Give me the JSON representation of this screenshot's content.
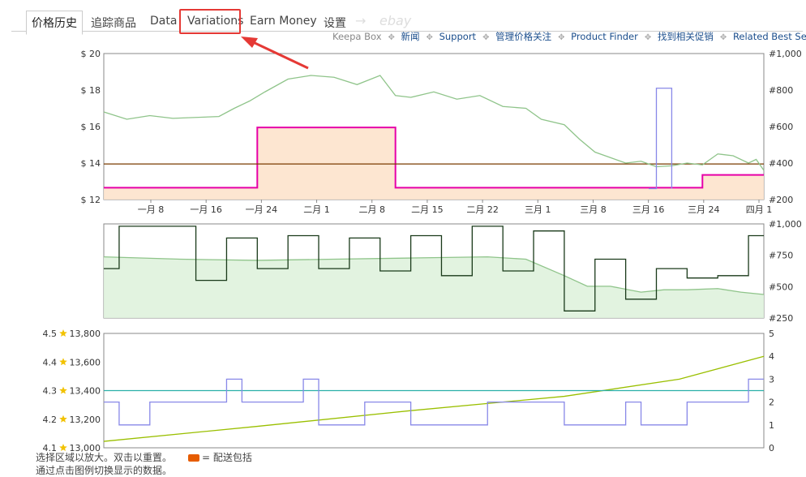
{
  "tabs": [
    {
      "label": "价格历史",
      "active": true
    },
    {
      "label": "追踪商品"
    },
    {
      "label": "Data"
    },
    {
      "label": "Variations",
      "highlighted": true
    },
    {
      "label": "Earn Money"
    },
    {
      "label": "设置"
    },
    {
      "label": "→",
      "decorative": true
    },
    {
      "label": "ebay",
      "decorative": true
    }
  ],
  "links": [
    "Keepa Box",
    "新闻",
    "Support",
    "管理价格关注",
    "Product Finder",
    "找到相关促销",
    "Related Best Sellers"
  ],
  "annotation": {
    "arrow_color": "#e53935",
    "highlight_color": "#e53935"
  },
  "footer": {
    "line1": "选择区域以放大。双击以重置。",
    "shipping_label": "= 配送包括",
    "line2": "通过点击图例切换显示的数据。"
  },
  "chart_data": [
    {
      "type": "line",
      "id": "price",
      "x_ticks": [
        "一月 8",
        "一月 16",
        "一月 24",
        "二月 1",
        "二月 8",
        "二月 15",
        "二月 22",
        "三月 1",
        "三月 8",
        "三月 16",
        "三月 24",
        "四月 1"
      ],
      "y_left": {
        "ticks": [
          "$ 12",
          "$ 14",
          "$ 16",
          "$ 18",
          "$ 20"
        ],
        "range": [
          12,
          20
        ]
      },
      "y_right": {
        "ticks": [
          "#200",
          "#400",
          "#600",
          "#800",
          "#1,000"
        ],
        "range": [
          200,
          1000
        ]
      },
      "x_range": [
        0,
        86
      ],
      "series": [
        {
          "key": "amazon",
          "color": "#e600a8",
          "fill": "#fde3cc",
          "axis": "left",
          "points": [
            [
              0,
              12.65
            ],
            [
              20,
              12.65
            ],
            [
              20,
              15.95
            ],
            [
              38,
              15.95
            ],
            [
              38,
              12.65
            ],
            [
              78,
              12.65
            ],
            [
              78,
              13.35
            ],
            [
              86,
              13.35
            ]
          ]
        },
        {
          "key": "new",
          "color": "#7a3b00",
          "axis": "left",
          "points": [
            [
              0,
              13.95
            ],
            [
              86,
              13.95
            ]
          ]
        },
        {
          "key": "sales_rank",
          "color": "#8fc48a",
          "axis": "right",
          "points": [
            [
              0,
              680
            ],
            [
              3,
              640
            ],
            [
              6,
              660
            ],
            [
              9,
              645
            ],
            [
              12,
              650
            ],
            [
              15,
              655
            ],
            [
              17,
              700
            ],
            [
              19,
              740
            ],
            [
              21,
              790
            ],
            [
              24,
              860
            ],
            [
              27,
              880
            ],
            [
              30,
              870
            ],
            [
              33,
              830
            ],
            [
              36,
              880
            ],
            [
              38,
              770
            ],
            [
              40,
              760
            ],
            [
              43,
              790
            ],
            [
              46,
              750
            ],
            [
              49,
              770
            ],
            [
              52,
              710
            ],
            [
              55,
              700
            ],
            [
              57,
              640
            ],
            [
              60,
              610
            ],
            [
              62,
              530
            ],
            [
              64,
              460
            ],
            [
              66,
              430
            ],
            [
              68,
              400
            ],
            [
              70,
              410
            ],
            [
              72,
              380
            ],
            [
              74,
              385
            ],
            [
              76,
              400
            ],
            [
              78,
              390
            ],
            [
              80,
              450
            ],
            [
              82,
              440
            ],
            [
              84,
              400
            ],
            [
              85,
              420
            ],
            [
              86,
              360
            ]
          ]
        },
        {
          "key": "lightning",
          "color": "#8888e8",
          "axis": "right",
          "points": [
            [
              71,
              260
            ],
            [
              72,
              260
            ],
            [
              72,
              810
            ],
            [
              74,
              810
            ],
            [
              74,
              260
            ]
          ]
        }
      ]
    },
    {
      "type": "line",
      "id": "offers",
      "y_right": {
        "ticks": [
          "#250",
          "#500",
          "#750",
          "#1,000"
        ],
        "range": [
          200,
          1000
        ]
      },
      "x_range": [
        0,
        86
      ],
      "series": [
        {
          "key": "rank_area",
          "color": "#8fc48a",
          "fill": "#dff2dd",
          "points": [
            [
              0,
              720
            ],
            [
              10,
              700
            ],
            [
              20,
              690
            ],
            [
              30,
              700
            ],
            [
              40,
              710
            ],
            [
              50,
              720
            ],
            [
              55,
              700
            ],
            [
              60,
              560
            ],
            [
              63,
              470
            ],
            [
              66,
              470
            ],
            [
              70,
              420
            ],
            [
              73,
              440
            ],
            [
              76,
              440
            ],
            [
              80,
              450
            ],
            [
              83,
              420
            ],
            [
              86,
              400
            ]
          ]
        },
        {
          "key": "offer_count",
          "color": "#1a3a1a",
          "points": [
            [
              0,
              620
            ],
            [
              2,
              620
            ],
            [
              2,
              980
            ],
            [
              12,
              980
            ],
            [
              12,
              520
            ],
            [
              16,
              520
            ],
            [
              16,
              880
            ],
            [
              20,
              880
            ],
            [
              20,
              620
            ],
            [
              24,
              620
            ],
            [
              24,
              900
            ],
            [
              28,
              900
            ],
            [
              28,
              620
            ],
            [
              32,
              620
            ],
            [
              32,
              880
            ],
            [
              36,
              880
            ],
            [
              36,
              600
            ],
            [
              40,
              600
            ],
            [
              40,
              900
            ],
            [
              44,
              900
            ],
            [
              44,
              560
            ],
            [
              48,
              560
            ],
            [
              48,
              980
            ],
            [
              52,
              980
            ],
            [
              52,
              600
            ],
            [
              56,
              600
            ],
            [
              56,
              940
            ],
            [
              60,
              940
            ],
            [
              60,
              260
            ],
            [
              64,
              260
            ],
            [
              64,
              700
            ],
            [
              68,
              700
            ],
            [
              68,
              360
            ],
            [
              72,
              360
            ],
            [
              72,
              620
            ],
            [
              76,
              620
            ],
            [
              76,
              540
            ],
            [
              80,
              540
            ],
            [
              80,
              560
            ],
            [
              84,
              560
            ],
            [
              84,
              900
            ],
            [
              86,
              900
            ]
          ]
        }
      ]
    },
    {
      "type": "line",
      "id": "reviews",
      "y_left": {
        "ticks": [
          "4.1",
          "4.2",
          "4.3",
          "4.4",
          "4.5"
        ],
        "range": [
          4.1,
          4.5
        ]
      },
      "y_left2": {
        "ticks": [
          "13,000",
          "13,200",
          "13,400",
          "13,600",
          "13,800"
        ],
        "range": [
          13000,
          13800
        ]
      },
      "y_right": {
        "ticks": [
          "0",
          "1",
          "2",
          "3",
          "4",
          "5"
        ],
        "range": [
          0,
          5
        ]
      },
      "x_range": [
        0,
        86
      ],
      "series": [
        {
          "key": "review_count",
          "color": "#9abf00",
          "axis": "left2",
          "points": [
            [
              0,
              13045
            ],
            [
              20,
              13150
            ],
            [
              40,
              13260
            ],
            [
              60,
              13360
            ],
            [
              75,
              13480
            ],
            [
              86,
              13640
            ]
          ]
        },
        {
          "key": "rating",
          "color": "#2ab0a8",
          "axis": "left",
          "points": [
            [
              0,
              4.3
            ],
            [
              86,
              4.3
            ]
          ]
        },
        {
          "key": "offer_stars",
          "color": "#8888e8",
          "axis": "right",
          "points": [
            [
              0,
              2
            ],
            [
              2,
              2
            ],
            [
              2,
              1
            ],
            [
              6,
              1
            ],
            [
              6,
              2
            ],
            [
              16,
              2
            ],
            [
              16,
              3
            ],
            [
              18,
              3
            ],
            [
              18,
              2
            ],
            [
              26,
              2
            ],
            [
              26,
              3
            ],
            [
              28,
              3
            ],
            [
              28,
              1
            ],
            [
              34,
              1
            ],
            [
              34,
              2
            ],
            [
              40,
              2
            ],
            [
              40,
              1
            ],
            [
              50,
              1
            ],
            [
              50,
              2
            ],
            [
              60,
              2
            ],
            [
              60,
              1
            ],
            [
              68,
              1
            ],
            [
              68,
              2
            ],
            [
              70,
              2
            ],
            [
              70,
              1
            ],
            [
              76,
              1
            ],
            [
              76,
              2
            ],
            [
              84,
              2
            ],
            [
              84,
              3
            ],
            [
              86,
              3
            ]
          ]
        }
      ]
    }
  ]
}
